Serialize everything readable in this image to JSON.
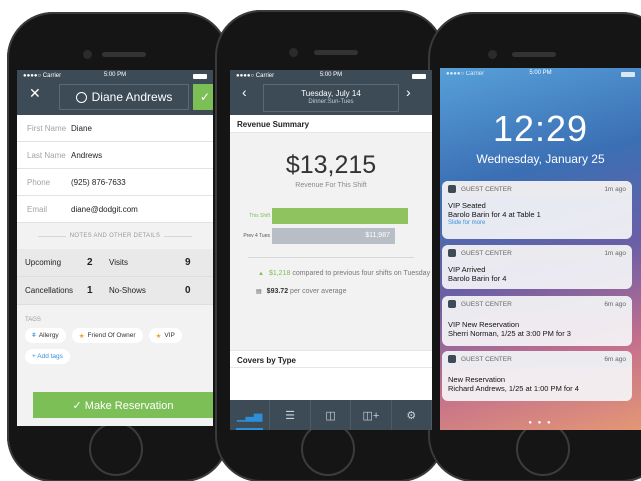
{
  "status": {
    "carrier": "●●●●○ Carrier",
    "time": "5:00 PM"
  },
  "guest": {
    "name": "Diane Andrews",
    "fields": [
      {
        "label": "First Name",
        "value": "Diane"
      },
      {
        "label": "Last Name",
        "value": "Andrews"
      },
      {
        "label": "Phone",
        "value": "(925) 876-7633"
      },
      {
        "label": "Email",
        "value": "diane@dodgit.com"
      }
    ],
    "notes_header": "NOTES AND OTHER DETAILS",
    "stats": [
      {
        "a_label": "Upcoming",
        "a_value": "2",
        "b_label": "Visits",
        "b_value": "9"
      },
      {
        "a_label": "Cancellations",
        "a_value": "1",
        "b_label": "No-Shows",
        "b_value": "0"
      }
    ],
    "tags_header": "TAGS",
    "tags": [
      "Allergy",
      "Friend Of Owner",
      "VIP"
    ],
    "add_tags": "+ Add tags",
    "make_reservation": "✓ Make Reservation"
  },
  "shift": {
    "date": "Tuesday, July 14",
    "subtitle": "Dinner:Sun-Tues",
    "revenue_header": "Revenue Summary",
    "revenue_value": "$13,215",
    "revenue_caption": "Revenue For This Shift",
    "bar_labels": [
      "This Shift",
      "Prev 4 Tues"
    ],
    "bar_value_label": "$11,987",
    "compare_value": "$1,218",
    "compare_text": "compared to previous four shifts on Tuesday",
    "per_cover_value": "$93.72",
    "per_cover_text": "per cover average",
    "covers_header": "Covers by Type"
  },
  "chart_data": {
    "type": "bar",
    "categories": [
      "This Shift",
      "Prev 4 Tues"
    ],
    "values": [
      13215,
      11987
    ],
    "colors": [
      "#8fc35f",
      "#b7bec6"
    ]
  },
  "lock": {
    "time": "12:29",
    "date": "Wednesday, January 25",
    "notifications": [
      {
        "app": "GUEST CENTER",
        "when": "1m ago",
        "line1": "VIP Seated",
        "line2": "Barolo Barin for 4 at Table 1",
        "more": "Slide for more"
      },
      {
        "app": "GUEST CENTER",
        "when": "1m ago",
        "line1": "VIP Arrived",
        "line2": "Barolo Barin for 4",
        "more": ""
      },
      {
        "app": "GUEST CENTER",
        "when": "6m ago",
        "line1": "VIP New Reservation",
        "line2": "Sherri Norman, 1/25 at 3:00 PM for 3",
        "more": ""
      },
      {
        "app": "GUEST CENTER",
        "when": "6m ago",
        "line1": "New Reservation",
        "line2": "Richard Andrews, 1/25 at 1:00 PM for 4",
        "more": ""
      }
    ]
  }
}
